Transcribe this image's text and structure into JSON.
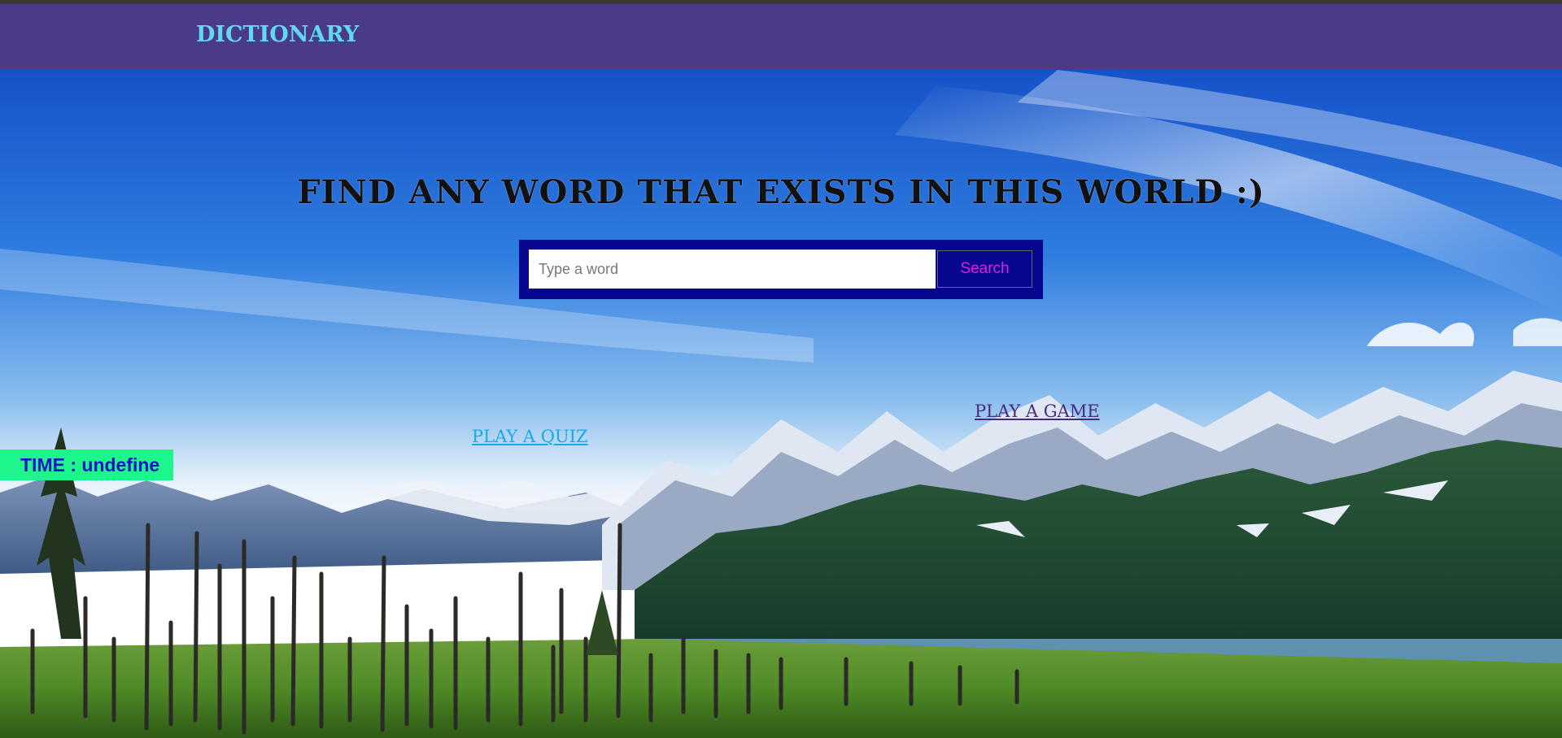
{
  "navbar": {
    "brand": "DICTIONARY"
  },
  "hero": {
    "headline": "FIND ANY WORD THAT EXISTS IN THIS WORLD :)"
  },
  "search": {
    "placeholder": "Type a word",
    "value": "",
    "button_label": "Search"
  },
  "links": {
    "game": "PLAY A GAME",
    "quiz": "PLAY A QUIZ"
  },
  "timer": {
    "label": "TIME : ",
    "value": "undefine"
  },
  "colors": {
    "navbar_bg": "#4b3a8a",
    "brand": "#5fd8f0",
    "search_panel": "#06068e",
    "search_button_text": "#e020e0",
    "timer_bg": "#1ef58a",
    "timer_text": "#1515c8",
    "link_game": "#4a2a7a",
    "link_quiz": "#1aa8e8"
  }
}
